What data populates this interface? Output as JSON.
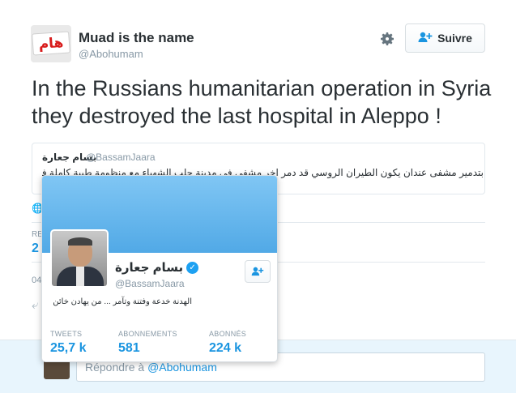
{
  "tweet": {
    "author_name": "Muad is the name",
    "author_handle": "@Abohumam",
    "avatar_text": "هام",
    "follow_label": "Suivre",
    "text": "In the Russians humanitarian operation in Syria they destroyed the last hospital in Aleppo !"
  },
  "quoted": {
    "author_name": "بسام جعارة",
    "author_handle": "@BassamJaara",
    "text": "بتدمير مشفى عندان يكون الطيران الروسي قد دمر اخر مشفى في مدينة حلب الشهباء مع منظومة طبية كاملة في مسكنة"
  },
  "stats": {
    "retweets_label": "RE",
    "retweets_value": "2",
    "date_prefix": "04"
  },
  "hovercard": {
    "name": "بسام جعارة",
    "handle": "@BassamJaara",
    "bio": "الهدنة خدعة وفتنة وتآمر ... من يهادن خائن",
    "stats": [
      {
        "label": "TWEETS",
        "value": "25,7 k"
      },
      {
        "label": "ABONNEMENTS",
        "value": "581"
      },
      {
        "label": "ABONNÉS",
        "value": "224 k"
      }
    ]
  },
  "reply": {
    "placeholder_prefix": "Répondre à ",
    "mention": "@Abohumam"
  },
  "colors": {
    "accent": "#1b95e0",
    "banner": "#51a9e6",
    "reply_bg": "#e8f5fd"
  }
}
